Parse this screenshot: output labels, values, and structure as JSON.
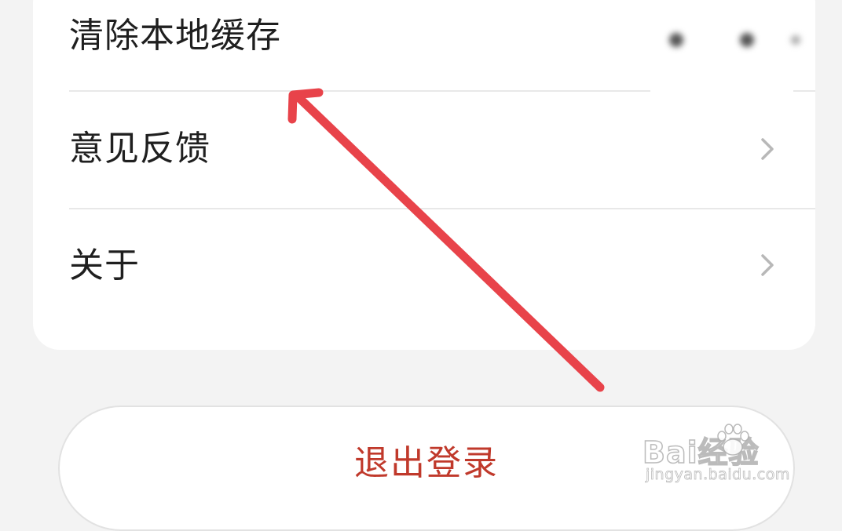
{
  "settings": {
    "items": [
      {
        "label": "清除本地缓存"
      },
      {
        "label": "意见反馈"
      },
      {
        "label": "关于"
      }
    ]
  },
  "logout": {
    "label": "退出登录"
  },
  "watermark": {
    "logo_text": "Bai经验",
    "site": "jingyan.baidu.com"
  },
  "colors": {
    "logout_text": "#c0392b",
    "arrow": "#e8434a",
    "background": "#f3f3f3"
  },
  "icons": {
    "row_chevron": "chevron-right-icon"
  }
}
